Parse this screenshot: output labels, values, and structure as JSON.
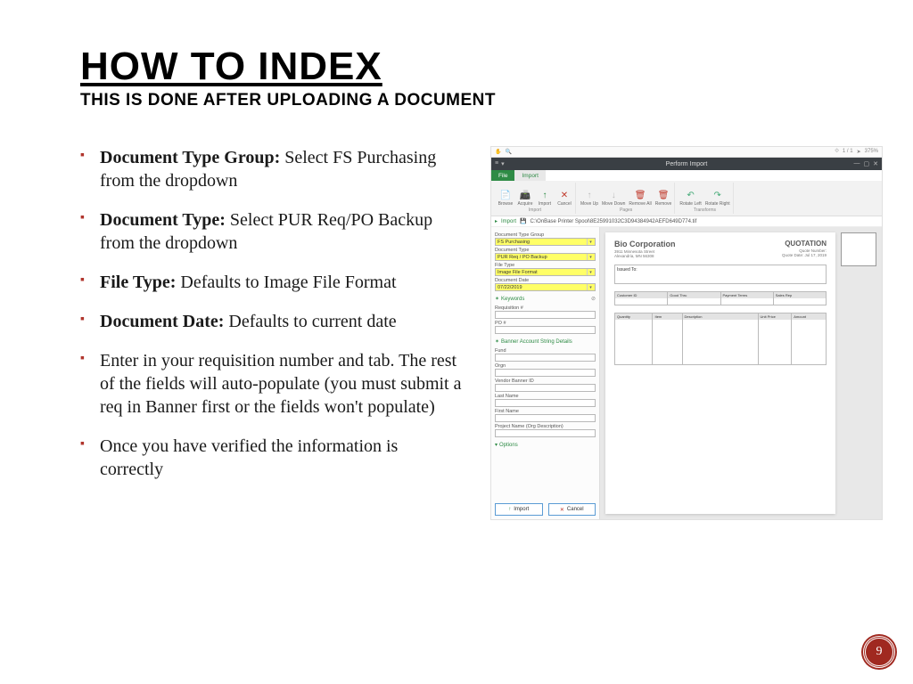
{
  "title": "HOW TO INDEX",
  "subtitle": "THIS IS DONE AFTER UPLOADING A DOCUMENT",
  "bullets": [
    {
      "bold": "Document Type Group:",
      "rest": "  Select FS Purchasing from the dropdown"
    },
    {
      "bold": "Document Type:",
      "rest": "  Select PUR Req/PO Backup from the dropdown"
    },
    {
      "bold": "File Type:",
      "rest": "  Defaults to Image File Format"
    },
    {
      "bold": "Document Date:",
      "rest": "  Defaults to current date"
    },
    {
      "bold": "",
      "rest": "Enter in your requisition number and tab.  The rest of the fields will auto-populate (you must submit a req in Banner first or the fields won't populate)"
    },
    {
      "bold": "",
      "rest": "Once you have verified the information is correctly"
    }
  ],
  "app": {
    "titlebar": "Perform Import",
    "tabs": {
      "file": "File",
      "import": "Import"
    },
    "ribbon": {
      "browse": "Browse",
      "acquire": "Acquire",
      "import": "Import",
      "cancel": "Cancel",
      "moveup": "Move Up",
      "movedown": "Move Down",
      "removeall": "Remove All",
      "remove": "Remove",
      "rotateleft": "Rotate Left",
      "rotateright": "Rotate Right",
      "g_import": "Import",
      "g_pages": "Pages",
      "g_transforms": "Transforms"
    },
    "path_label": "Import",
    "path": "C:\\OnBase Printer Spool\\8E25991032C3D94384942AEFD649D774.tif",
    "fields": {
      "dtg_l": "Document Type Group",
      "dtg_v": "FS Purchasing",
      "dt_l": "Document Type",
      "dt_v": "PUR Req / PO Backup",
      "ft_l": "File Type",
      "ft_v": "Image File Format",
      "dd_l": "Document Date",
      "dd_v": "07/22/2019",
      "kw_head": "Keywords",
      "req_l": "Requisition #",
      "po_l": "PO #",
      "bas_head": "Banner Account String Details",
      "fund_l": "Fund",
      "orgn_l": "Orgn",
      "vbid_l": "Vendor Banner ID",
      "ln_l": "Last Name",
      "fn_l": "First Name",
      "pn_l": "Project Name (Org Description)",
      "opt_head": "Options",
      "btn_import": "Import",
      "btn_cancel": "Cancel"
    },
    "doc": {
      "company": "Bio Corporation",
      "quotation": "QUOTATION",
      "addr1": "3911 Minnesota Street",
      "addr2": "Alexandria, MN 56308",
      "quote_no_l": "Quote Number:",
      "quote_date_l": "Quote Date:",
      "quote_date_v": "Jul 17, 2019",
      "issued_to": "Issued To:",
      "th": [
        "Customer ID",
        "Good Thru",
        "Payment Terms",
        "Sales Rep"
      ],
      "th2": [
        "Quantity",
        "Item",
        "Description",
        "Unit Price",
        "Amount"
      ]
    }
  },
  "page_number": "9"
}
